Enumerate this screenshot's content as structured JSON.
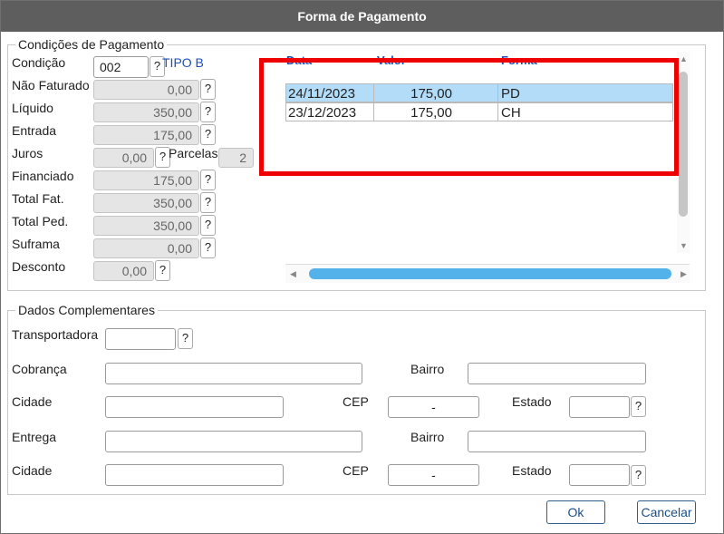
{
  "dialog": {
    "title": "Forma de Pagamento"
  },
  "payment": {
    "legend": "Condições de Pagamento",
    "condicao": {
      "label": "Condição",
      "value": "002",
      "desc": "TIPO B"
    },
    "nao_faturado": {
      "label": "Não Faturado",
      "value": "0,00"
    },
    "liquido": {
      "label": "Líquido",
      "value": "350,00"
    },
    "entrada": {
      "label": "Entrada",
      "value": "175,00"
    },
    "juros": {
      "label": "Juros",
      "value": "0,00"
    },
    "parcelas": {
      "label": "Parcelas",
      "value": "2"
    },
    "financiado": {
      "label": "Financiado",
      "value": "175,00"
    },
    "total_fat": {
      "label": "Total Fat.",
      "value": "350,00"
    },
    "total_ped": {
      "label": "Total Ped.",
      "value": "350,00"
    },
    "suframa": {
      "label": "Suframa",
      "value": "0,00"
    },
    "desconto": {
      "label": "Desconto",
      "value": "0,00"
    },
    "help": "?"
  },
  "grid": {
    "columns": [
      "Data",
      "Valor",
      "Forma"
    ],
    "rows": [
      {
        "data": "24/11/2023",
        "valor": "175,00",
        "forma": "PD"
      },
      {
        "data": "23/12/2023",
        "valor": "175,00",
        "forma": "CH"
      }
    ],
    "scroll_up": "▲",
    "scroll_down": "▼",
    "scroll_left": "◀",
    "scroll_right": "▶"
  },
  "extra": {
    "legend": "Dados Complementares",
    "transportadora": {
      "label": "Transportadora",
      "value": ""
    },
    "cobranca": {
      "label": "Cobrança",
      "value": ""
    },
    "bairro1": {
      "label": "Bairro",
      "value": ""
    },
    "cidade1": {
      "label": "Cidade",
      "value": ""
    },
    "cep1": {
      "label": "CEP",
      "value": "-"
    },
    "estado1": {
      "label": "Estado",
      "value": ""
    },
    "entrega": {
      "label": "Entrega",
      "value": ""
    },
    "bairro2": {
      "label": "Bairro",
      "value": ""
    },
    "cidade2": {
      "label": "Cidade",
      "value": ""
    },
    "cep2": {
      "label": "CEP",
      "value": "-"
    },
    "estado2": {
      "label": "Estado",
      "value": ""
    }
  },
  "buttons": {
    "ok": "Ok",
    "cancel": "Cancelar"
  },
  "colors": {
    "titlebar": "#5e5e5e",
    "selected_row": "#b3dcf9",
    "highlight": "#ee0000",
    "scroll_thumb": "#54b2ea"
  }
}
